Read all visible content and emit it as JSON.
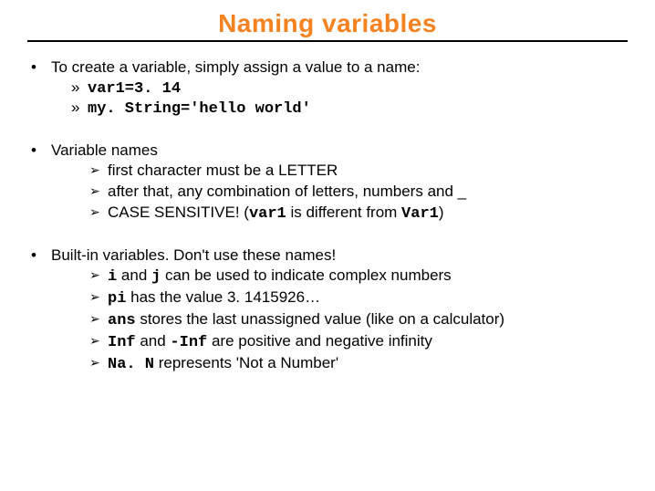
{
  "title": "Naming variables",
  "s1": {
    "head": "To create a variable, simply assign a value to a name:",
    "a": "var1=3. 14",
    "b": "my. String='hello world'"
  },
  "s2": {
    "head": "Variable names",
    "a": "first character must be a LETTER",
    "b": "after that, any combination of letters, numbers and _",
    "c1": "CASE SENSITIVE! (",
    "c2": "var1",
    "c3": " is different from ",
    "c4": "Var1",
    "c5": ")"
  },
  "s3": {
    "head": "Built-in variables. Don't use these names!",
    "a1": "i",
    "a2": " and ",
    "a3": "j",
    "a4": " can be used to indicate complex numbers",
    "b1": "pi",
    "b2": " has the value 3. 1415926…",
    "c1": "ans",
    "c2": " stores the last unassigned value (like on a calculator)",
    "d1": "Inf",
    "d2": " and ",
    "d3": "-Inf",
    "d4": " are positive and negative infinity",
    "e1": "Na. N",
    "e2": "  represents 'Not a Number'"
  }
}
